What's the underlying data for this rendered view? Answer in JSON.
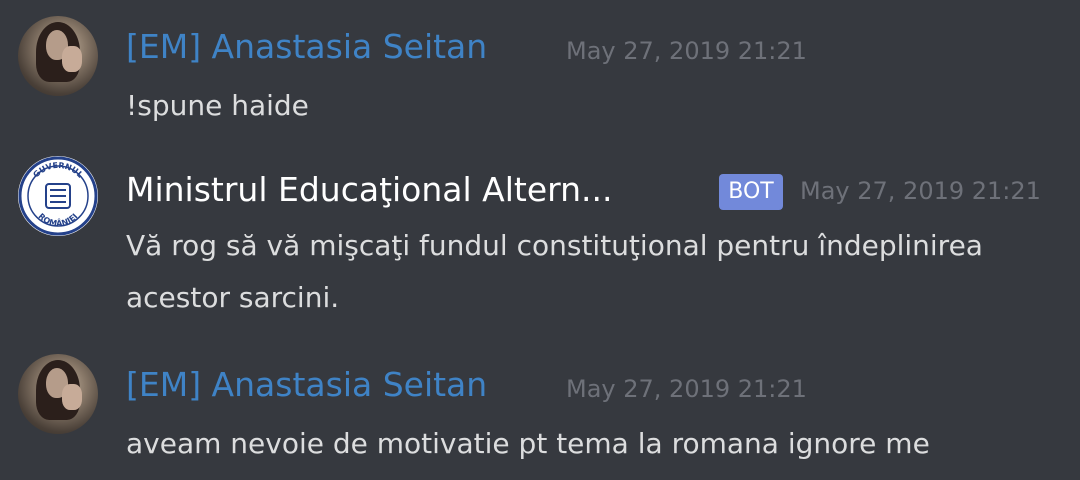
{
  "messages": [
    {
      "author": "[EM] Anastasia Seitan",
      "timestamp": "May 27, 2019 21:21",
      "content": "!spune haide"
    },
    {
      "author": "Ministrul Educaţional Altern...",
      "badge": "BOT",
      "timestamp": "May 27, 2019 21:21",
      "content": "Vă rog să vă mişcaţi fundul constituţional pentru îndeplinirea acestor sarcini."
    },
    {
      "author": "[EM] Anastasia Seitan",
      "timestamp": "May 27, 2019 21:21",
      "content": "aveam nevoie de motivatie pt tema la romana ignore me"
    }
  ],
  "bot_avatar": {
    "seal_text_top": "GUVERNUL",
    "seal_text_bottom": "ROMÂNIEI"
  },
  "colors": {
    "background": "#36393f",
    "user_name": "#3f83c6",
    "bot_name": "#ffffff",
    "bot_badge": "#7289da",
    "timestamp": "#6e7179",
    "message_text": "#dcddde"
  }
}
